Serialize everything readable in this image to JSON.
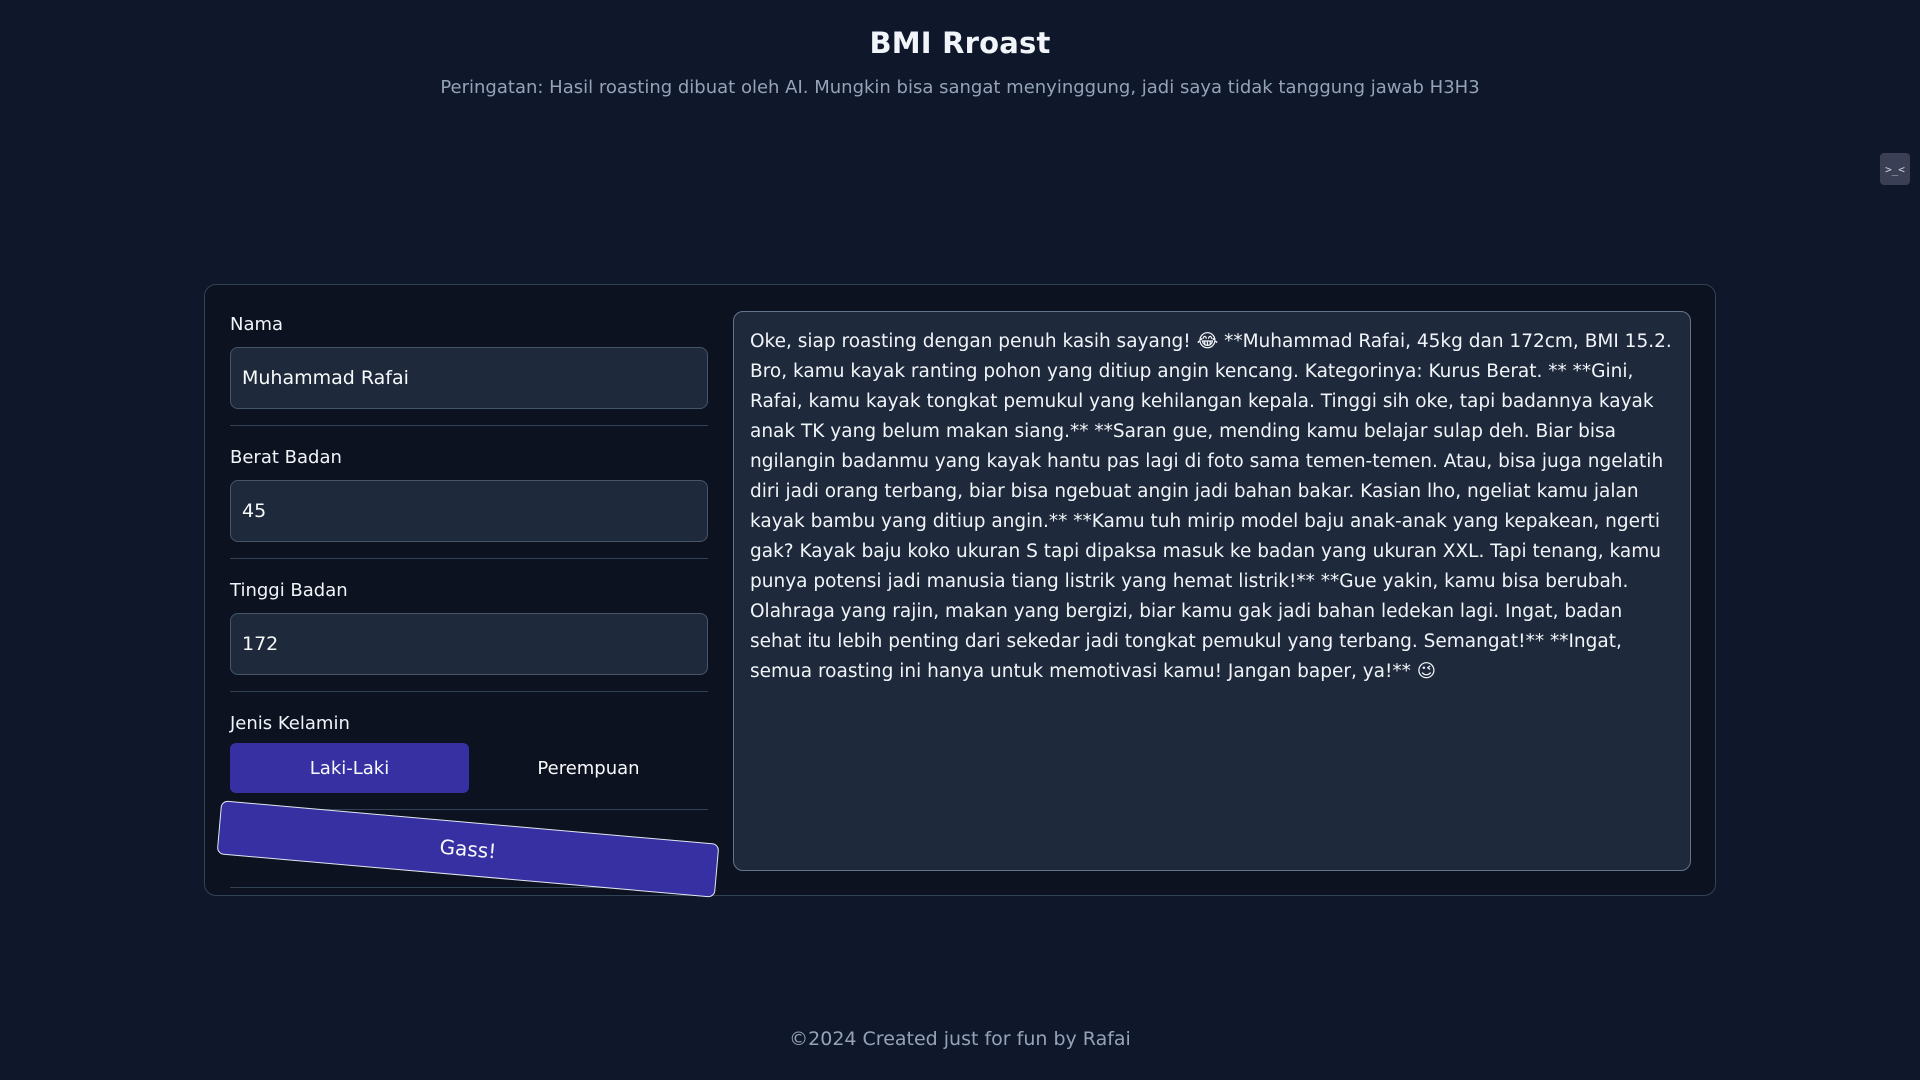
{
  "header": {
    "title": "BMI Rroast",
    "subtitle": "Peringatan: Hasil roasting dibuat oleh AI. Mungkin bisa sangat menyinggung, jadi saya tidak tanggung jawab H3H3"
  },
  "side_icon": {
    "glyph": ">_<",
    "icon": "extension-icon"
  },
  "form": {
    "name_label": "Nama",
    "name_value": "Muhammad Rafai",
    "weight_label": "Berat Badan",
    "weight_value": "45",
    "height_label": "Tinggi Badan",
    "height_value": "172",
    "gender_label": "Jenis Kelamin",
    "gender_male": "Laki-Laki",
    "gender_female": "Perempuan",
    "selected_gender": "Laki-Laki",
    "submit_label": "Gass!"
  },
  "result": {
    "text": "Oke, siap roasting dengan penuh kasih sayang! 😂 **Muhammad Rafai, 45kg dan 172cm, BMI 15.2. Bro, kamu kayak ranting pohon yang ditiup angin kencang. Kategorinya: Kurus Berat. ** **Gini, Rafai, kamu kayak tongkat pemukul yang kehilangan kepala. Tinggi sih oke, tapi badannya kayak anak TK yang belum makan siang.** **Saran gue, mending kamu belajar sulap deh. Biar bisa ngilangin badanmu yang kayak hantu pas lagi di foto sama temen-temen. Atau, bisa juga ngelatih diri jadi orang terbang, biar bisa ngebuat angin jadi bahan bakar. Kasian lho, ngeliat kamu jalan kayak bambu yang ditiup angin.** **Kamu tuh mirip model baju anak-anak yang kepakean, ngerti gak? Kayak baju koko ukuran S tapi dipaksa masuk ke badan yang ukuran XXL. Tapi tenang, kamu punya potensi jadi manusia tiang listrik yang hemat listrik!** **Gue yakin, kamu bisa berubah. Olahraga yang rajin, makan yang bergizi, biar kamu gak jadi bahan ledekan lagi. Ingat, badan sehat itu lebih penting dari sekedar jadi tongkat pemukul yang terbang. Semangat!** **Ingat, semua roasting ini hanya untuk memotivasi kamu! Jangan baper, ya!** 😉"
  },
  "footer": {
    "text": "©2024 Created just for fun by Rafai"
  },
  "colors": {
    "background": "#0f172a",
    "accent": "#3730a3",
    "input_bg": "#1e293b",
    "border": "#334155"
  }
}
